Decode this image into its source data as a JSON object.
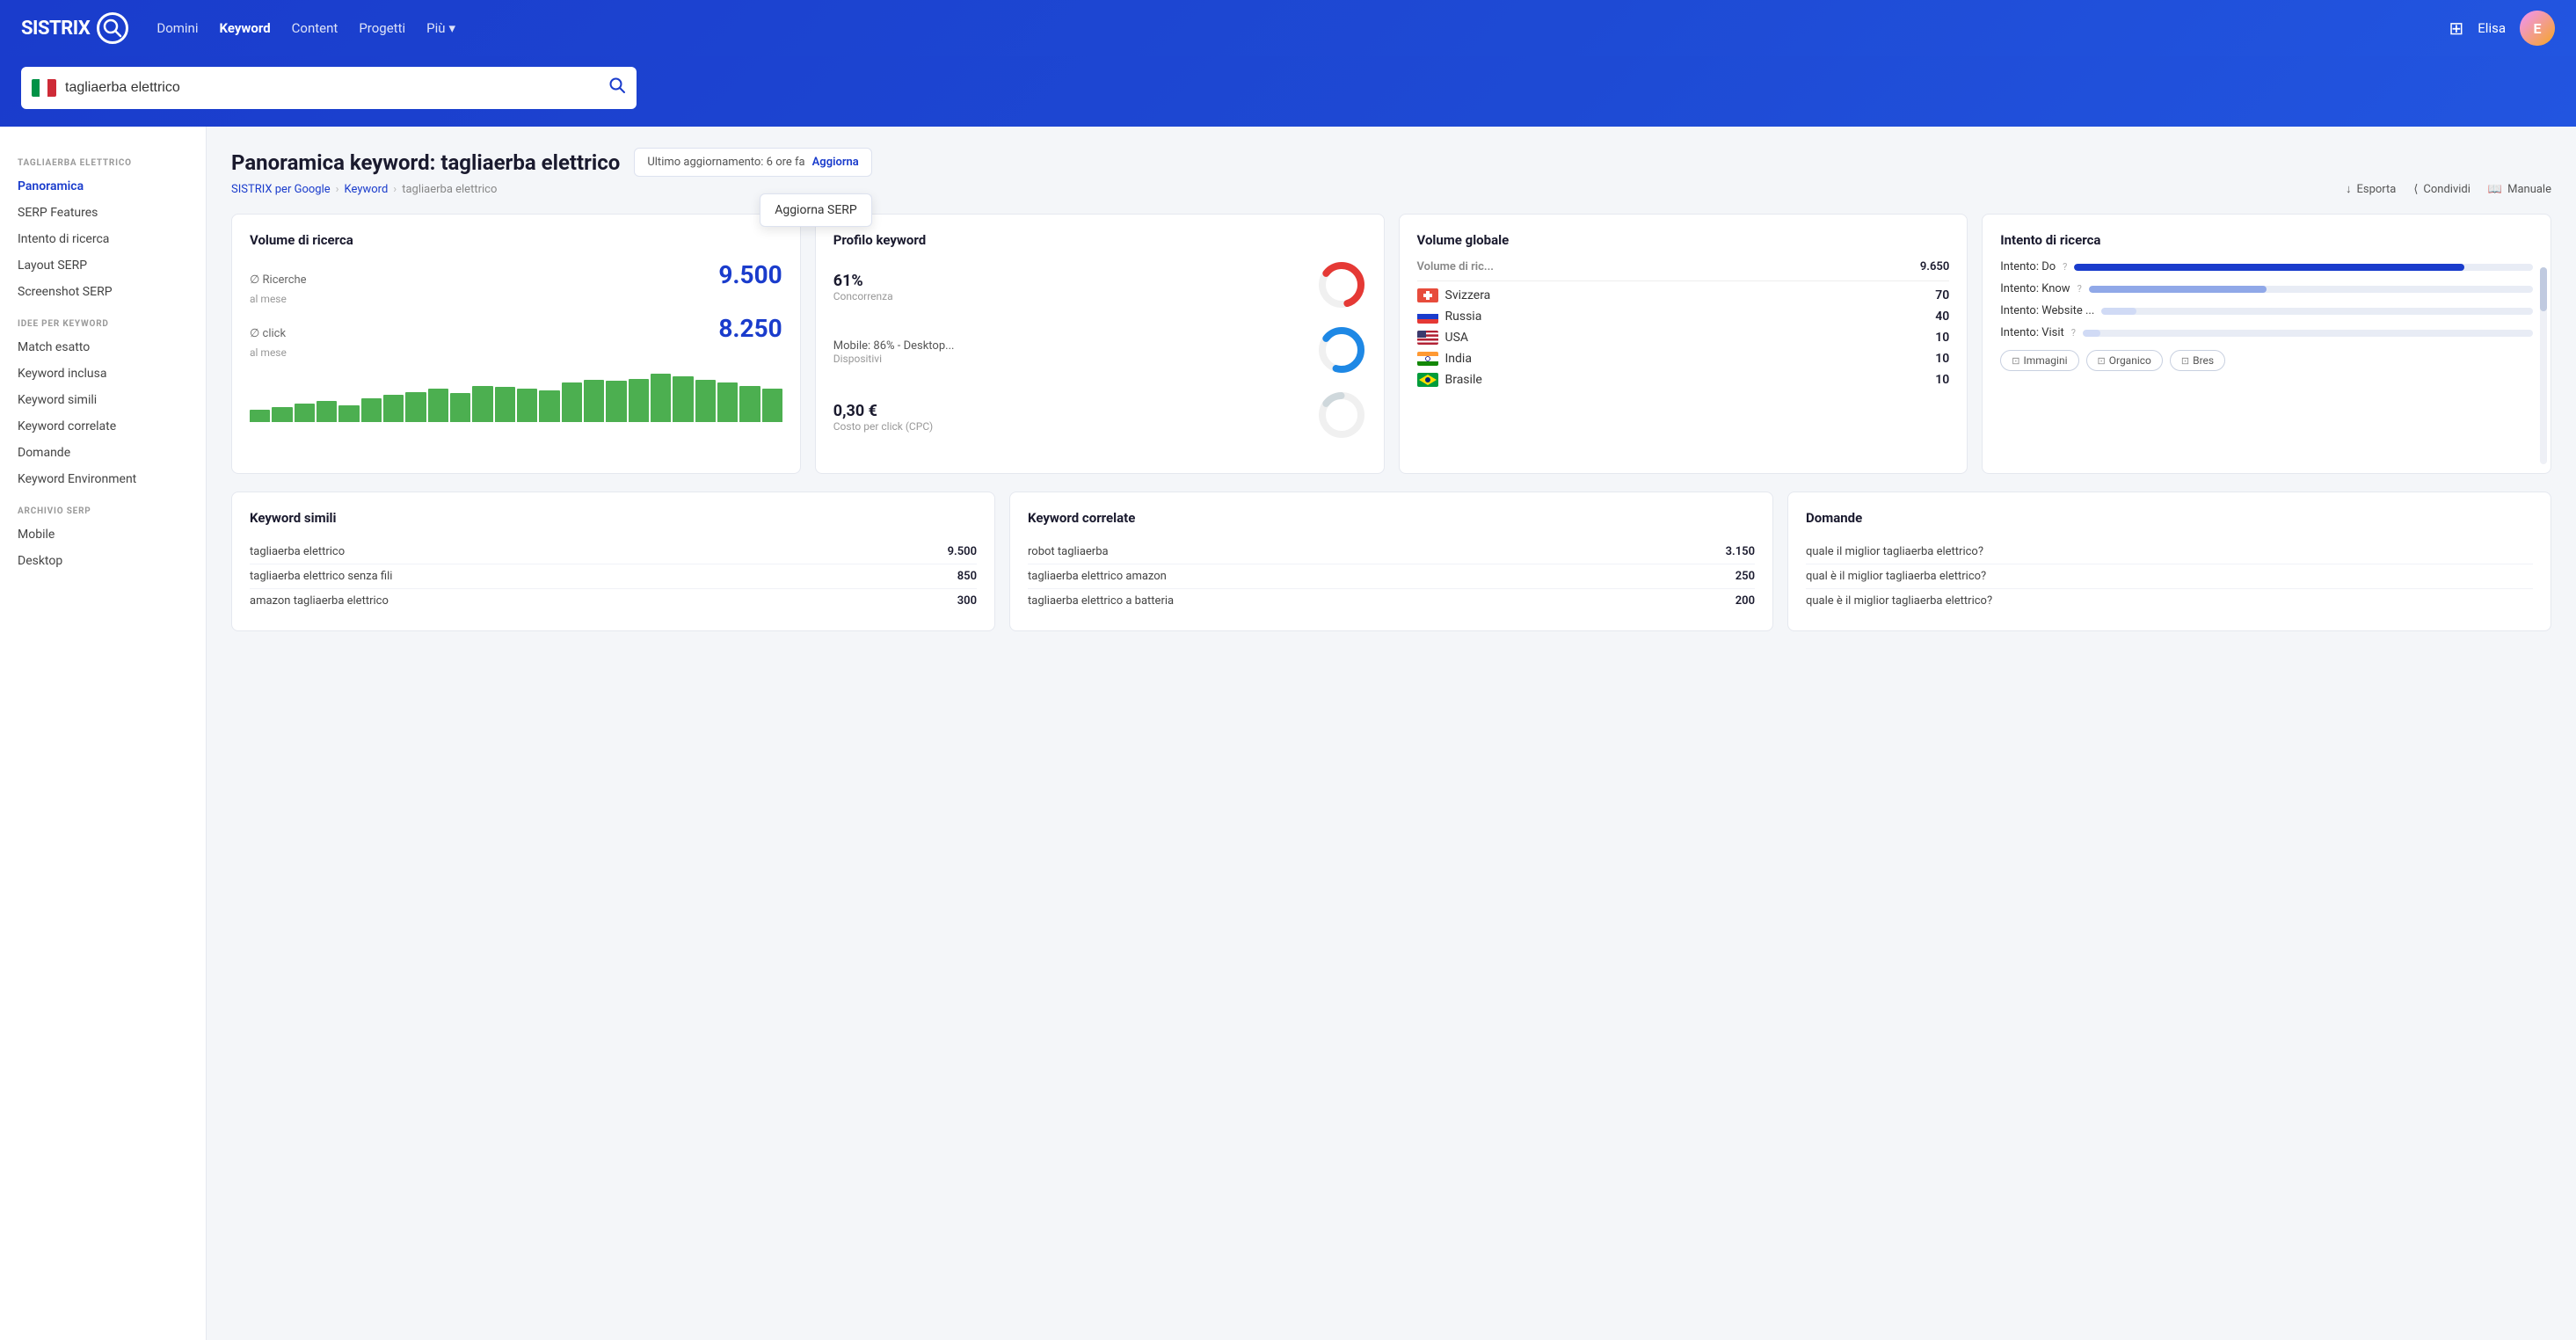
{
  "brand": {
    "name": "SISTRIX",
    "logo_char": "Q"
  },
  "nav": {
    "links": [
      {
        "label": "Domini",
        "active": false
      },
      {
        "label": "Keyword",
        "active": true
      },
      {
        "label": "Content",
        "active": false
      },
      {
        "label": "Progetti",
        "active": false
      },
      {
        "label": "Più",
        "active": false,
        "has_arrow": true
      }
    ],
    "username": "Elisa",
    "avatar_initials": "E"
  },
  "search": {
    "query": "tagliaerba elettrico",
    "placeholder": "tagliaerba elettrico",
    "flag_country": "IT"
  },
  "page": {
    "title_prefix": "Panoramica keyword:",
    "title_keyword": "tagliaerba elettrico",
    "last_update": "Ultimo aggiornamento: 6 ore fa",
    "update_link": "Aggiorna",
    "dropdown_label": "Aggiorna SERP",
    "breadcrumbs": [
      {
        "label": "SISTRIX per Google"
      },
      {
        "label": "Keyword"
      },
      {
        "label": "tagliaerba elettrico"
      }
    ],
    "actions": [
      {
        "label": "Esporta",
        "icon": "download"
      },
      {
        "label": "Condividi",
        "icon": "share"
      },
      {
        "label": "Manuale",
        "icon": "book"
      }
    ]
  },
  "sidebar": {
    "keyword_section_title": "TAGLIAERBA ELETTRICO",
    "keyword_items": [
      {
        "label": "Panoramica",
        "active": true
      },
      {
        "label": "SERP Features",
        "active": false
      },
      {
        "label": "Intento di ricerca",
        "active": false
      },
      {
        "label": "Layout SERP",
        "active": false
      },
      {
        "label": "Screenshot SERP",
        "active": false
      }
    ],
    "idee_title": "IDEE PER KEYWORD",
    "idee_items": [
      {
        "label": "Match esatto",
        "active": false
      },
      {
        "label": "Keyword inclusa",
        "active": false
      },
      {
        "label": "Keyword simili",
        "active": false
      },
      {
        "label": "Keyword correlate",
        "active": false
      },
      {
        "label": "Domande",
        "active": false
      },
      {
        "label": "Keyword Environment",
        "active": false
      }
    ],
    "archivio_title": "ARCHIVIO SERP",
    "archivio_items": [
      {
        "label": "Mobile",
        "active": false
      },
      {
        "label": "Desktop",
        "active": false
      }
    ]
  },
  "volume_card": {
    "title": "Volume di ricerca",
    "ricerche_label": "∅ Ricerche",
    "ricerche_value": "9.500",
    "ricerche_sub": "al mese",
    "click_label": "∅ click",
    "click_value": "8.250",
    "click_sub": "al mese",
    "bars": [
      20,
      25,
      30,
      35,
      28,
      40,
      45,
      50,
      55,
      48,
      60,
      58,
      55,
      52,
      65,
      70,
      68,
      72,
      80,
      75,
      70,
      65,
      60,
      55
    ]
  },
  "profilo_card": {
    "title": "Profilo keyword",
    "concorrenza_pct": "61%",
    "concorrenza_label": "Concorrenza",
    "dispositivi_label": "Mobile: 86% - Desktop...",
    "dispositivi_sub": "Dispositivi",
    "cpc_value": "0,30 €",
    "cpc_label": "Costo per click (CPC)"
  },
  "volume_globale_card": {
    "title": "Volume globale",
    "header_label": "Volume di ric...",
    "header_value": "9.650",
    "countries": [
      {
        "flag": "ch",
        "name": "Svizzera",
        "value": 70
      },
      {
        "flag": "ru",
        "name": "Russia",
        "value": 40
      },
      {
        "flag": "us",
        "name": "USA",
        "value": 10
      },
      {
        "flag": "in",
        "name": "India",
        "value": 10
      },
      {
        "flag": "br",
        "name": "Brasile",
        "value": 10
      }
    ]
  },
  "intento_card": {
    "title": "Intento di ricerca",
    "items": [
      {
        "label": "Intento: Do",
        "pct": 85,
        "has_help": true
      },
      {
        "label": "Intento: Know",
        "pct": 40,
        "has_help": true
      },
      {
        "label": "Intento: Website ...",
        "pct": 8,
        "has_help": false
      },
      {
        "label": "Intento: Visit",
        "pct": 4,
        "has_help": true
      }
    ],
    "tags": [
      {
        "label": "Immagini"
      },
      {
        "label": "Organico"
      },
      {
        "label": "Bres"
      }
    ]
  },
  "keyword_simili_card": {
    "title": "Keyword simili",
    "items": [
      {
        "keyword": "tagliaerba elettrico",
        "volume": "9.500"
      },
      {
        "keyword": "tagliaerba elettrico senza fili",
        "volume": "850"
      },
      {
        "keyword": "amazon tagliaerba elettrico",
        "volume": "300"
      }
    ]
  },
  "keyword_correlate_card": {
    "title": "Keyword correlate",
    "items": [
      {
        "keyword": "robot tagliaerba",
        "volume": "3.150"
      },
      {
        "keyword": "tagliaerba elettrico amazon",
        "volume": "250"
      },
      {
        "keyword": "tagliaerba elettrico a batteria",
        "volume": "200"
      }
    ]
  },
  "domande_card": {
    "title": "Domande",
    "items": [
      {
        "keyword": "quale il miglior tagliaerba elettrico?"
      },
      {
        "keyword": "qual è il miglior tagliaerba elettrico?"
      },
      {
        "keyword": "quale è il miglior tagliaerba elettrico?"
      }
    ]
  }
}
